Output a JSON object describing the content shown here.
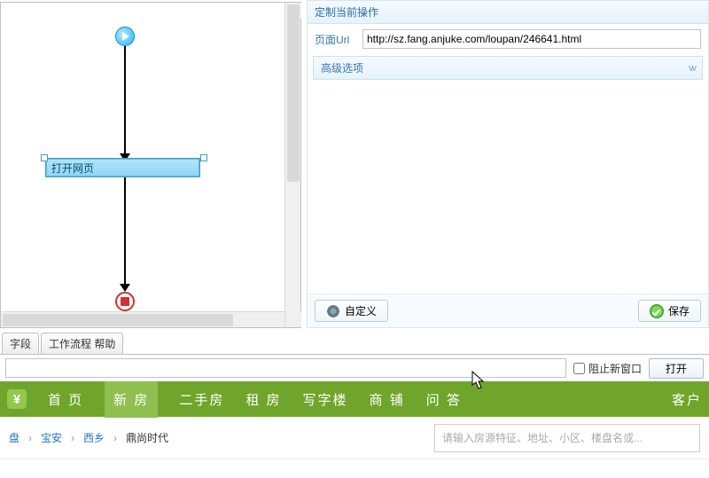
{
  "prop_panel": {
    "title": "定制当前操作",
    "url_label": "页面Url",
    "url_value": "http://sz.fang.anjuke.com/loupan/246641.html",
    "advanced_label": "高级选项",
    "customize_btn": "自定义",
    "save_btn": "保存"
  },
  "workflow": {
    "open_node_label": "打开网页"
  },
  "tabs": {
    "fields": "字段",
    "workflow_help": "工作流程 帮助"
  },
  "url_bar": {
    "value": "",
    "block_popup": "阻止新窗口",
    "open": "打开"
  },
  "nav": {
    "home": "首 页",
    "new_house": "新 房",
    "second_hand": "二手房",
    "rent": "租 房",
    "office": "写字楼",
    "shop": "商 铺",
    "qa": "问 答",
    "customer": "客户"
  },
  "breadcrumb": {
    "b1": "盘",
    "b2": "宝安",
    "b3": "西乡",
    "b4": "鼎尚时代",
    "search_placeholder": "请输入房源特征、地址、小区、楼盘名或..."
  }
}
